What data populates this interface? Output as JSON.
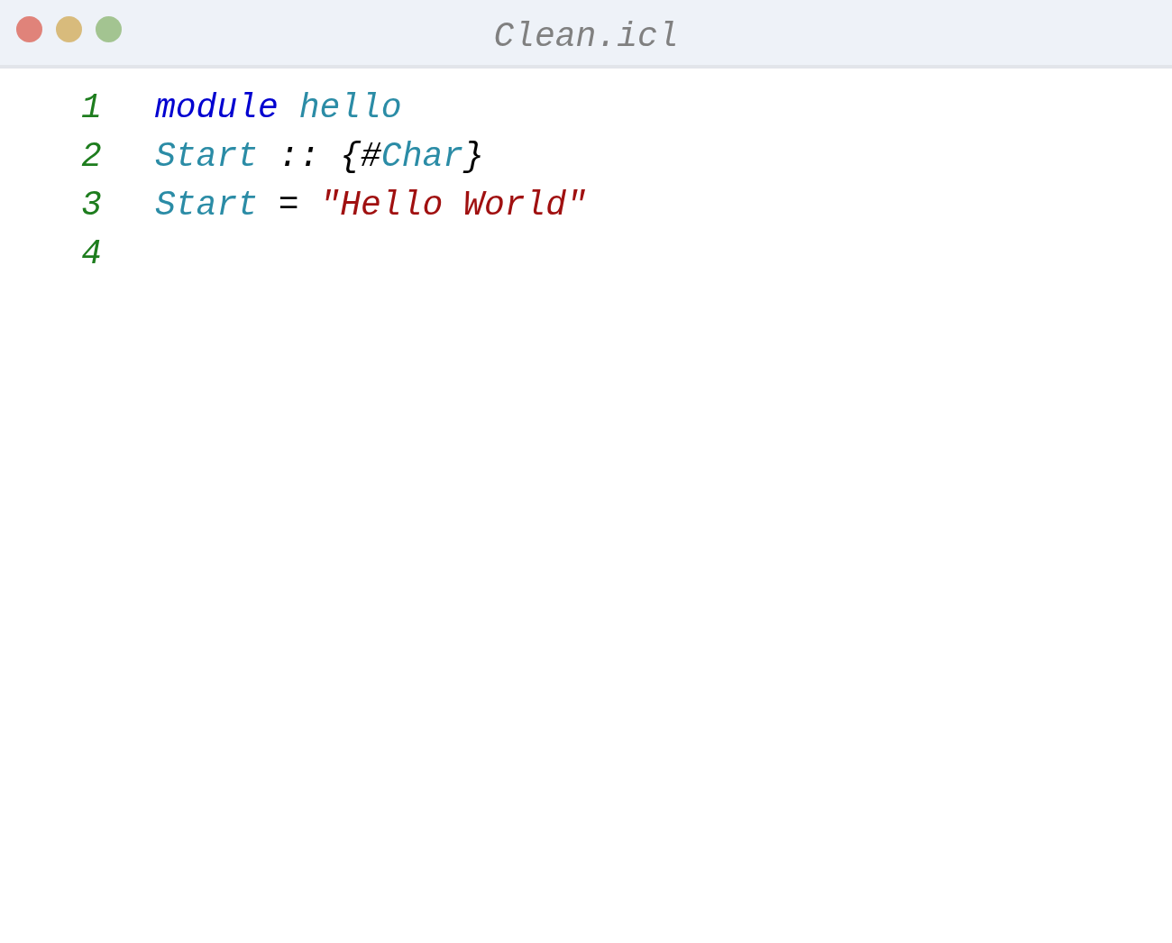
{
  "window": {
    "title": "Clean.icl"
  },
  "lines": [
    {
      "number": "1",
      "tokens": [
        {
          "text": "module",
          "kind": "keyword"
        },
        {
          "text": " hello",
          "kind": "identifier"
        }
      ]
    },
    {
      "number": "2",
      "tokens": [
        {
          "text": "Start",
          "kind": "identifier"
        },
        {
          "text": " :: {#",
          "kind": "punct"
        },
        {
          "text": "Char",
          "kind": "identifier"
        },
        {
          "text": "}",
          "kind": "punct"
        }
      ]
    },
    {
      "number": "3",
      "tokens": [
        {
          "text": "Start",
          "kind": "identifier"
        },
        {
          "text": " = ",
          "kind": "punct"
        },
        {
          "text": "\"Hello World\"",
          "kind": "string"
        }
      ]
    },
    {
      "number": "4"
    }
  ]
}
